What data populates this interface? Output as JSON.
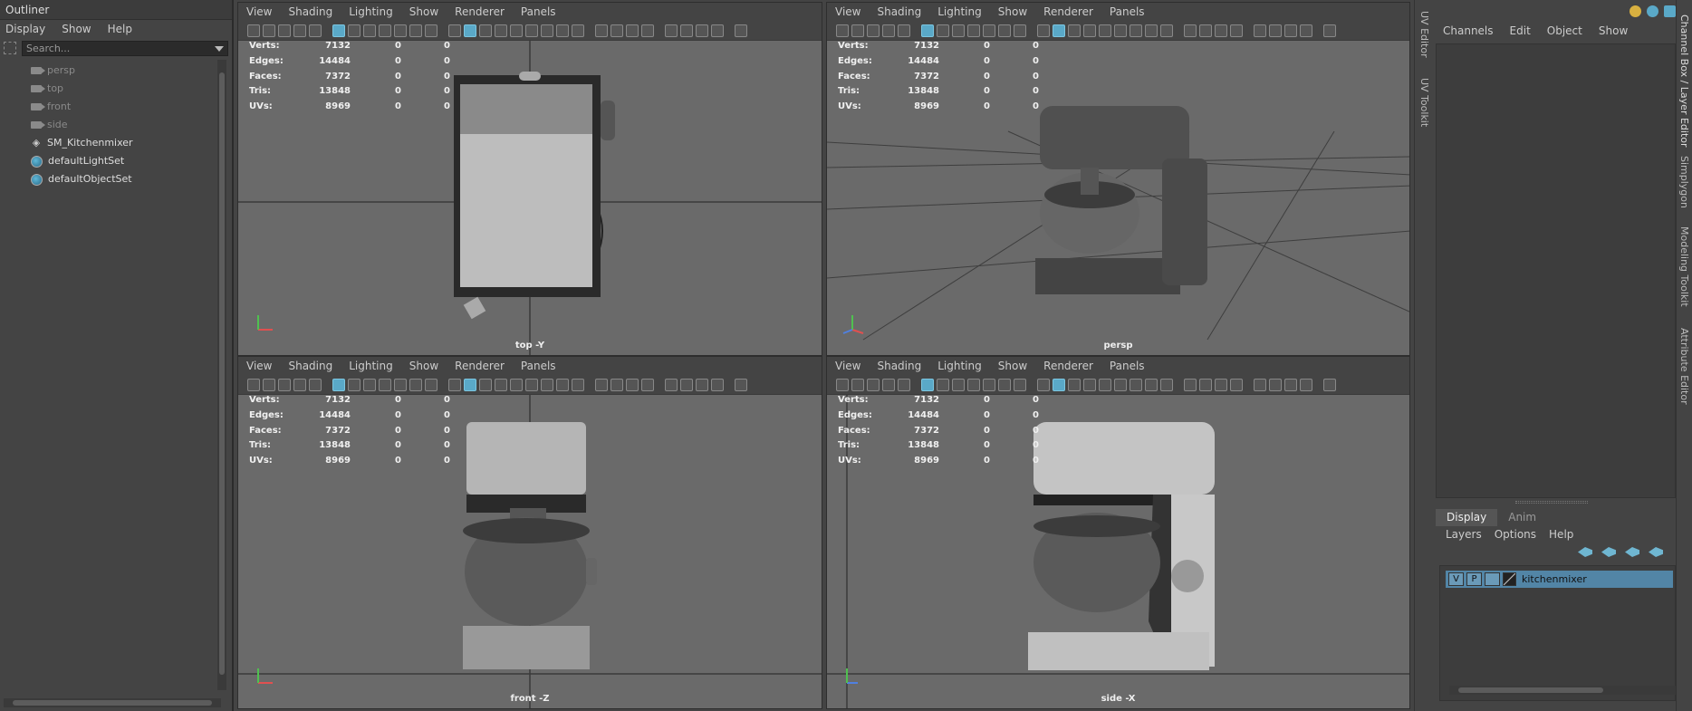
{
  "outliner": {
    "title": "Outliner",
    "menu": [
      "Display",
      "Show",
      "Help"
    ],
    "search_placeholder": "Search...",
    "items": [
      {
        "label": "persp",
        "icon": "camera-icon"
      },
      {
        "label": "top",
        "icon": "camera-icon"
      },
      {
        "label": "front",
        "icon": "camera-icon"
      },
      {
        "label": "side",
        "icon": "camera-icon"
      },
      {
        "label": "SM_Kitchenmixer",
        "icon": "mesh-icon"
      },
      {
        "label": "defaultLightSet",
        "icon": "set-icon"
      },
      {
        "label": "defaultObjectSet",
        "icon": "set-icon"
      }
    ]
  },
  "viewport_menu": [
    "View",
    "Shading",
    "Lighting",
    "Show",
    "Renderer",
    "Panels"
  ],
  "hud": {
    "rows": [
      {
        "label": "Verts:",
        "v1": "7132",
        "v2": "0",
        "v3": "0"
      },
      {
        "label": "Edges:",
        "v1": "14484",
        "v2": "0",
        "v3": "0"
      },
      {
        "label": "Faces:",
        "v1": "7372",
        "v2": "0",
        "v3": "0"
      },
      {
        "label": "Tris:",
        "v1": "13848",
        "v2": "0",
        "v3": "0"
      },
      {
        "label": "UVs:",
        "v1": "8969",
        "v2": "0",
        "v3": "0"
      }
    ]
  },
  "viewports": {
    "top": {
      "camera": "top -Y"
    },
    "persp": {
      "camera": "persp"
    },
    "front": {
      "camera": "front -Z"
    },
    "side": {
      "camera": "side -X"
    }
  },
  "side_tabs": {
    "uv_editor": "UV Editor",
    "uv_toolkit": "UV Toolkit",
    "channel_box": "Channel Box / Layer Editor",
    "simplygon": "Simplygon",
    "modeling_toolkit": "Modeling Toolkit",
    "attribute_editor": "Attribute Editor"
  },
  "channel_box": {
    "menu": [
      "Channels",
      "Edit",
      "Object",
      "Show"
    ]
  },
  "layer_editor": {
    "tabs": {
      "display": "Display",
      "anim": "Anim"
    },
    "menu": [
      "Layers",
      "Options",
      "Help"
    ],
    "layer": {
      "v": "V",
      "p": "P",
      "name": "kitchenmixer"
    }
  },
  "colors": {
    "accent": "#5aa9c8",
    "selected_layer": "#5285a6",
    "viewport_bg": "#6a6a6a"
  }
}
